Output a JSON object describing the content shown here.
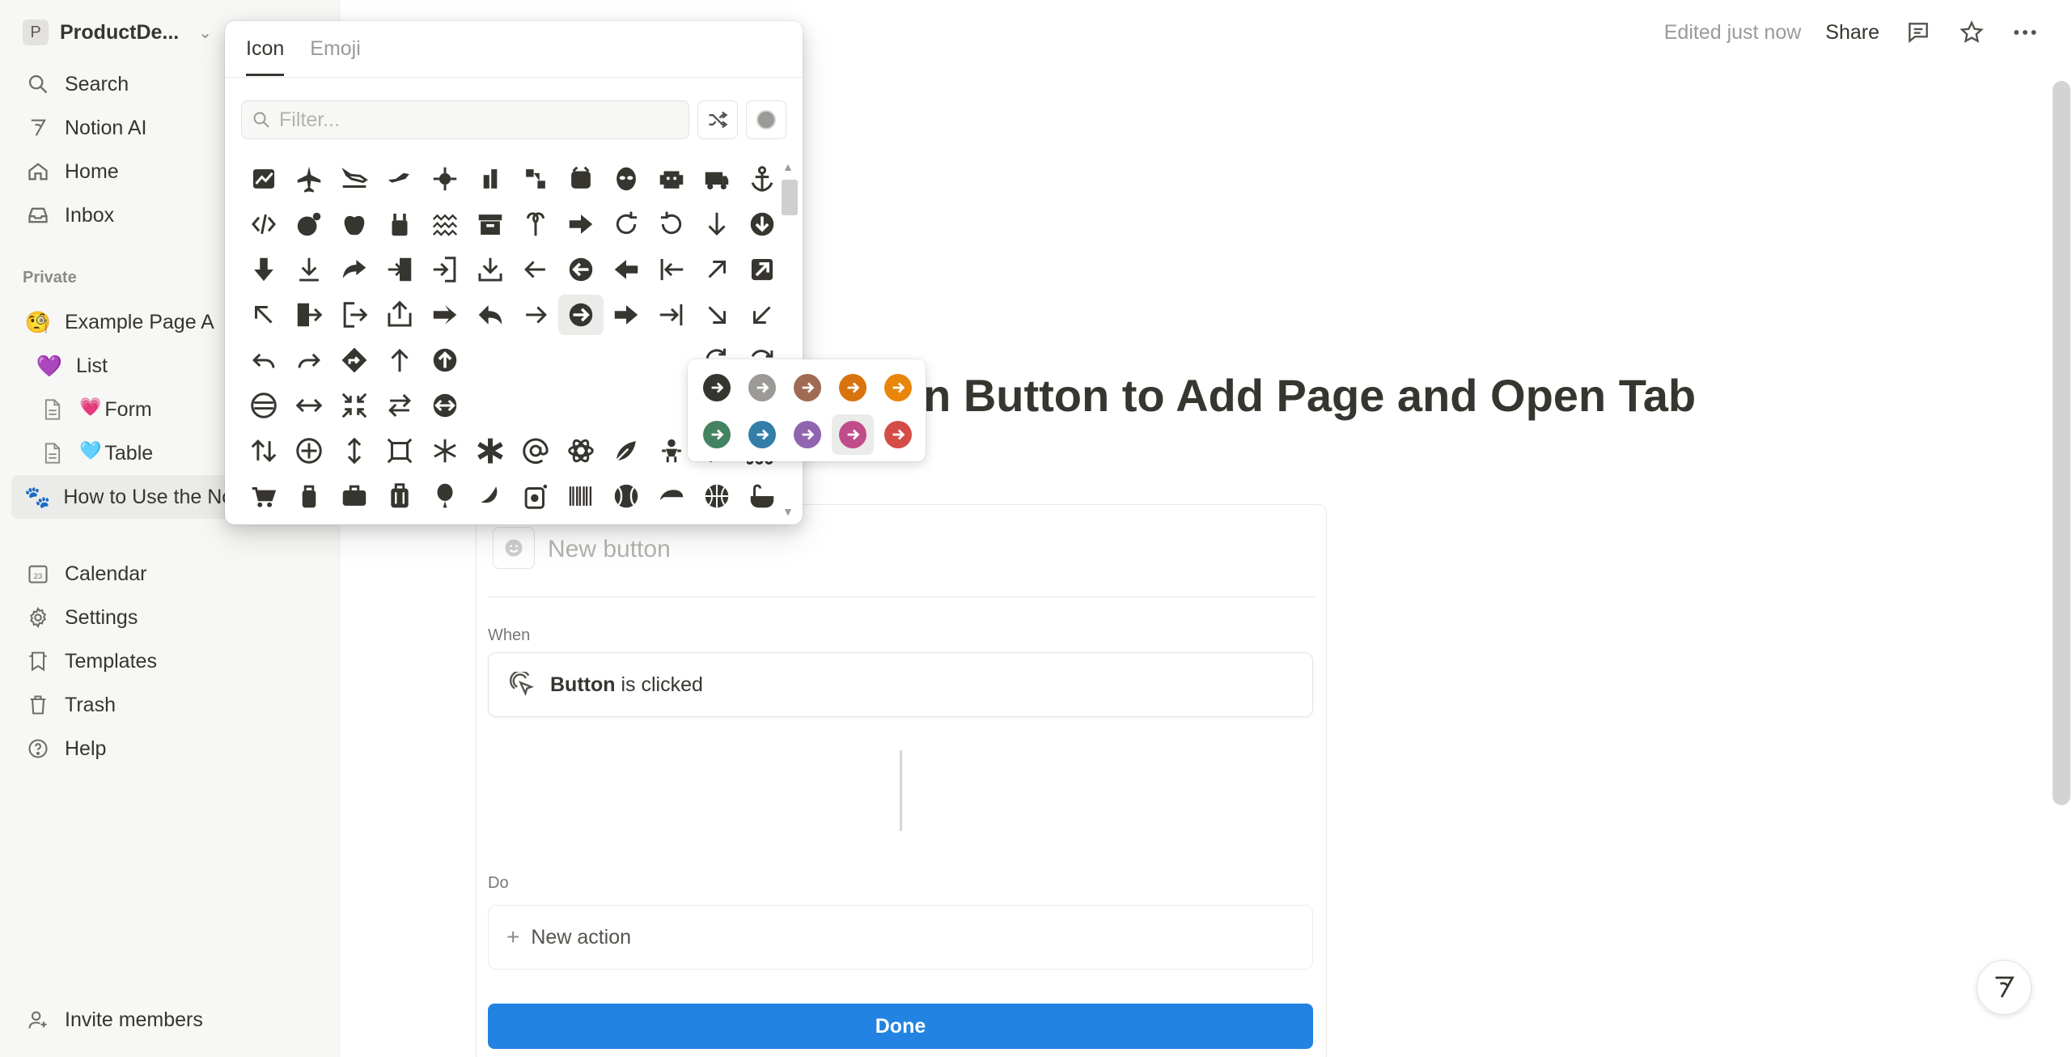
{
  "workspace": {
    "initial": "P",
    "name": "ProductDe..."
  },
  "sidebar": {
    "top_items": [
      {
        "label": "Search",
        "icon": "search-icon"
      },
      {
        "label": "Notion AI",
        "icon": "notion-ai-icon"
      },
      {
        "label": "Home",
        "icon": "home-icon"
      },
      {
        "label": "Inbox",
        "icon": "inbox-icon"
      }
    ],
    "section_label": "Private",
    "pages": [
      {
        "label": "Example Page A",
        "emoji": "🧐"
      },
      {
        "label": "List",
        "emoji": "💜"
      },
      {
        "label": "Form",
        "emoji": "💗"
      },
      {
        "label": "Table",
        "emoji": "🩵"
      },
      {
        "label": "How to Use the Notion Button to Add Page and Open Tab",
        "emoji": "🐾"
      }
    ],
    "bottom_items": [
      {
        "label": "Calendar",
        "icon": "calendar-icon",
        "icon_text": "23"
      },
      {
        "label": "Settings",
        "icon": "gear-icon"
      },
      {
        "label": "Templates",
        "icon": "templates-icon"
      },
      {
        "label": "Trash",
        "icon": "trash-icon"
      },
      {
        "label": "Help",
        "icon": "help-icon"
      }
    ],
    "invite": "Invite members"
  },
  "topbar": {
    "edited": "Edited just now",
    "share": "Share"
  },
  "page": {
    "title": "Notion Button to Add Page and Open Tab"
  },
  "editor": {
    "button_placeholder": "New button",
    "when_label": "When",
    "trigger_bold": "Button",
    "trigger_rest": " is clicked",
    "do_label": "Do",
    "new_action": "New action",
    "done": "Done"
  },
  "picker": {
    "tabs": [
      "Icon",
      "Emoji"
    ],
    "filter_placeholder": "Filter...",
    "variant_colors": [
      "#37352f",
      "#9b9a97",
      "#9f6b53",
      "#d9730d",
      "#e8850b",
      "#448361",
      "#337ea9",
      "#9065b0",
      "#c14c8a",
      "#d44c47"
    ]
  },
  "colors": {
    "accent": "#2383e2",
    "sidebar_bg": "#f7f7f5",
    "text": "#37352f"
  }
}
